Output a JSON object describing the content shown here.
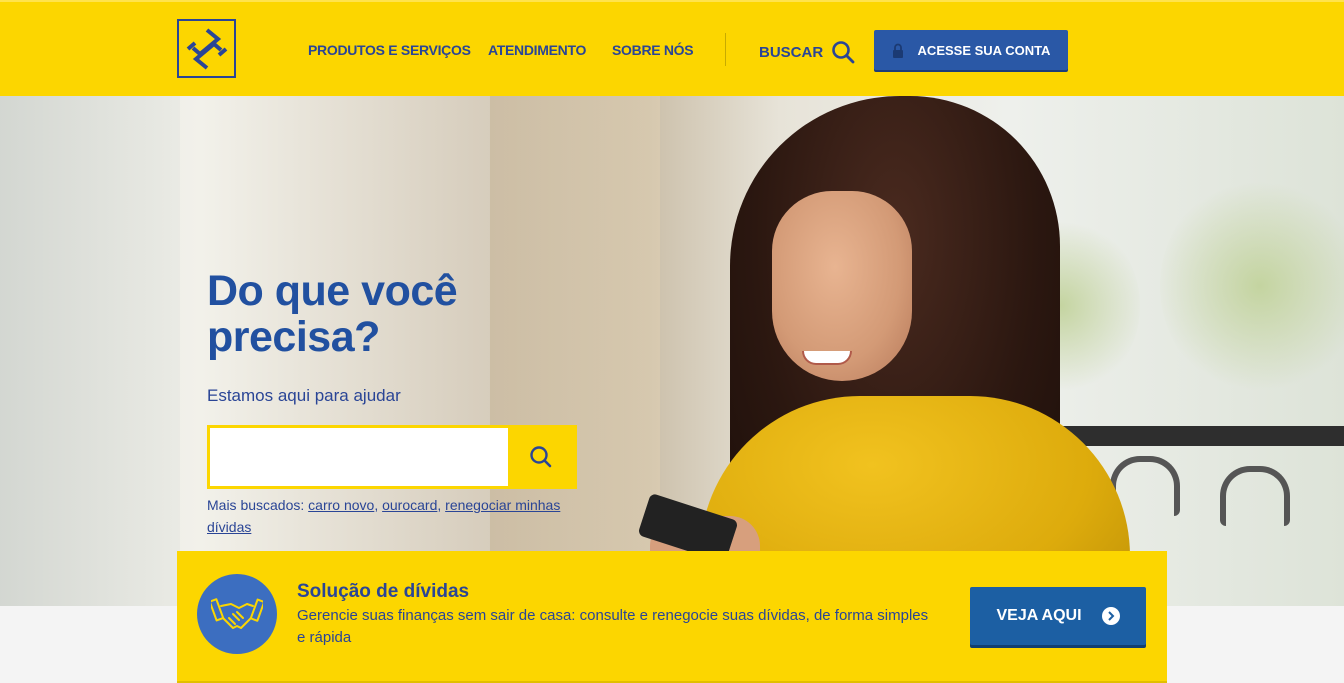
{
  "header": {
    "nav": [
      {
        "label": "PRODUTOS E SERVIÇOS"
      },
      {
        "label": "ATENDIMENTO"
      },
      {
        "label": "SOBRE NÓS"
      }
    ],
    "search_label": "BUSCAR",
    "login_label": "ACESSE SUA CONTA"
  },
  "hero": {
    "headline_line1": "Do que você",
    "headline_line2": "precisa?",
    "subtitle": "Estamos aqui para ajudar",
    "search": {
      "value": "",
      "placeholder": ""
    },
    "popular_prefix": "Mais buscados:",
    "popular_links": [
      "carro novo",
      "ourocard",
      "renegociar minhas dívidas"
    ]
  },
  "promo": {
    "title": "Solução de dívidas",
    "description": "Gerencie suas finanças sem sair de casa: consulte e renegocie suas dívidas, de forma simples e rápida",
    "button_label": "VEJA AQUI"
  },
  "colors": {
    "brand_yellow": "#fcd600",
    "brand_blue": "#2a4596",
    "button_blue": "#1c5fa3"
  },
  "icons": [
    "bb-logo-icon",
    "search-icon",
    "lock-icon",
    "handshake-icon",
    "arrow-right-circle-icon"
  ]
}
